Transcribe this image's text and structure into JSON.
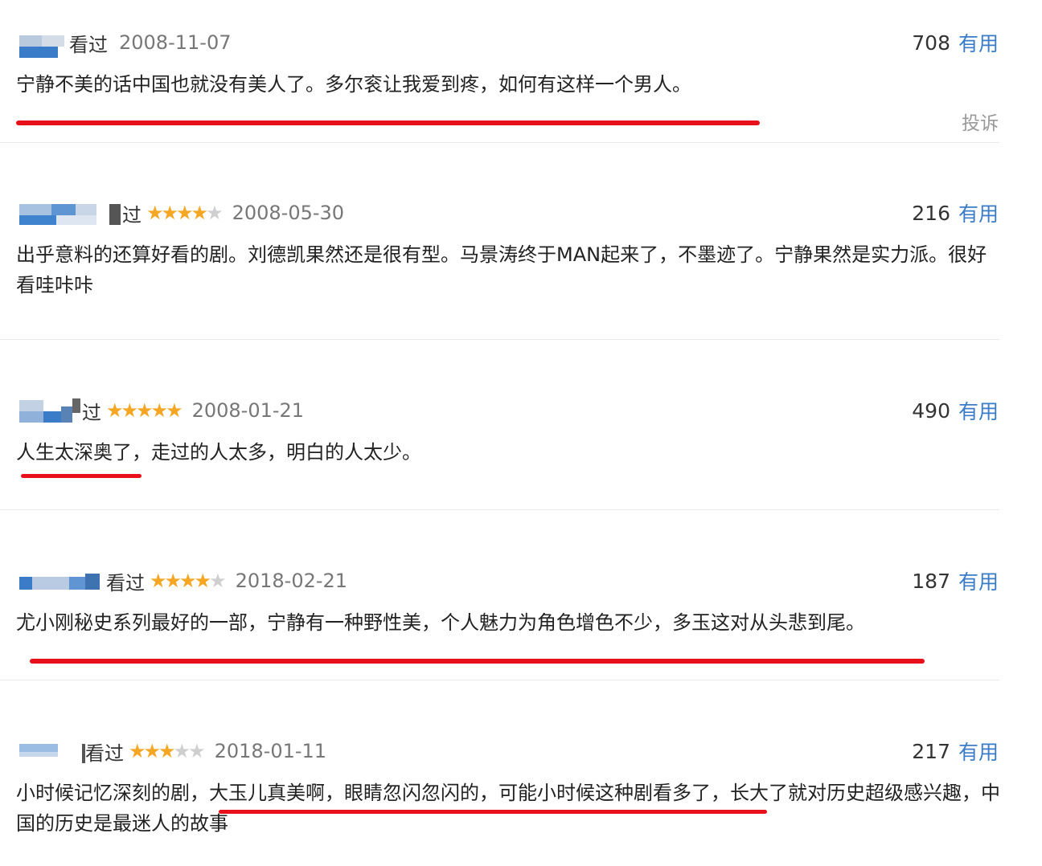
{
  "reviews": [
    {
      "status": "看过",
      "stars": 0,
      "date": "2008-11-07",
      "votes": "708",
      "useful_label": "有用",
      "text": "宁静不美的话中国也就没有美人了。多尔衮让我爱到疼，如何有这样一个男人。",
      "report_label": "投诉"
    },
    {
      "status": "过",
      "stars": 4,
      "date": "2008-05-30",
      "votes": "216",
      "useful_label": "有用",
      "text": "出乎意料的还算好看的剧。刘德凯果然还是很有型。马景涛终于MAN起来了，不墨迹了。宁静果然是实力派。很好看哇咔咔"
    },
    {
      "status": "过",
      "stars": 5,
      "date": "2008-01-21",
      "votes": "490",
      "useful_label": "有用",
      "text": "人生太深奥了，走过的人太多，明白的人太少。"
    },
    {
      "status": "看过",
      "stars": 4,
      "date": "2018-02-21",
      "votes": "187",
      "useful_label": "有用",
      "text": "尤小刚秘史系列最好的一部，宁静有一种野性美，个人魅力为角色增色不少，多玉这对从头悲到尾。"
    },
    {
      "status": "看过",
      "stars": 3,
      "date": "2018-01-11",
      "votes": "217",
      "useful_label": "有用",
      "text": "小时候记忆深刻的剧，大玉儿真美啊，眼睛忽闪忽闪的，可能小时候这种剧看多了，长大了就对历史超级感兴趣，中国的历史是最迷人的故事"
    }
  ],
  "colors": {
    "accent": "#3a7cc8",
    "star": "#f5a623",
    "highlight_line": "#e8101a"
  }
}
